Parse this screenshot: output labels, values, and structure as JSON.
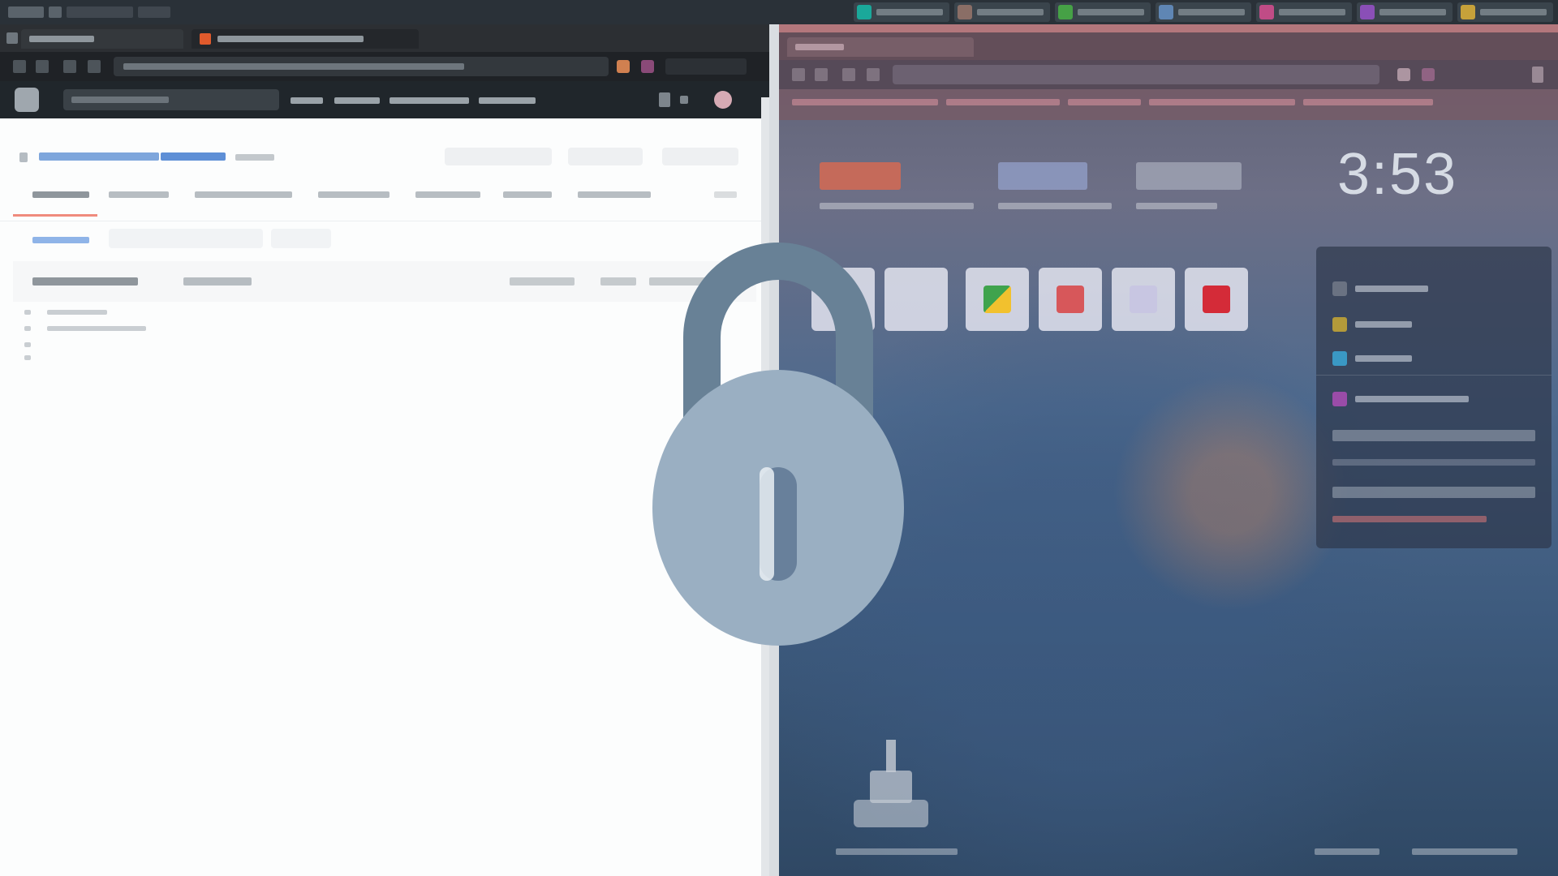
{
  "screen": {
    "state": "locked",
    "lock_icon": "padlock-icon",
    "lock_color": "#9aafc2",
    "lock_shackle_color": "#688196"
  },
  "right_window": {
    "clock": "3:53"
  },
  "colors": {
    "stat_1": "#e36a4c",
    "stat_2": "#9aa9d6",
    "stat_3": "#b9c0cc"
  }
}
